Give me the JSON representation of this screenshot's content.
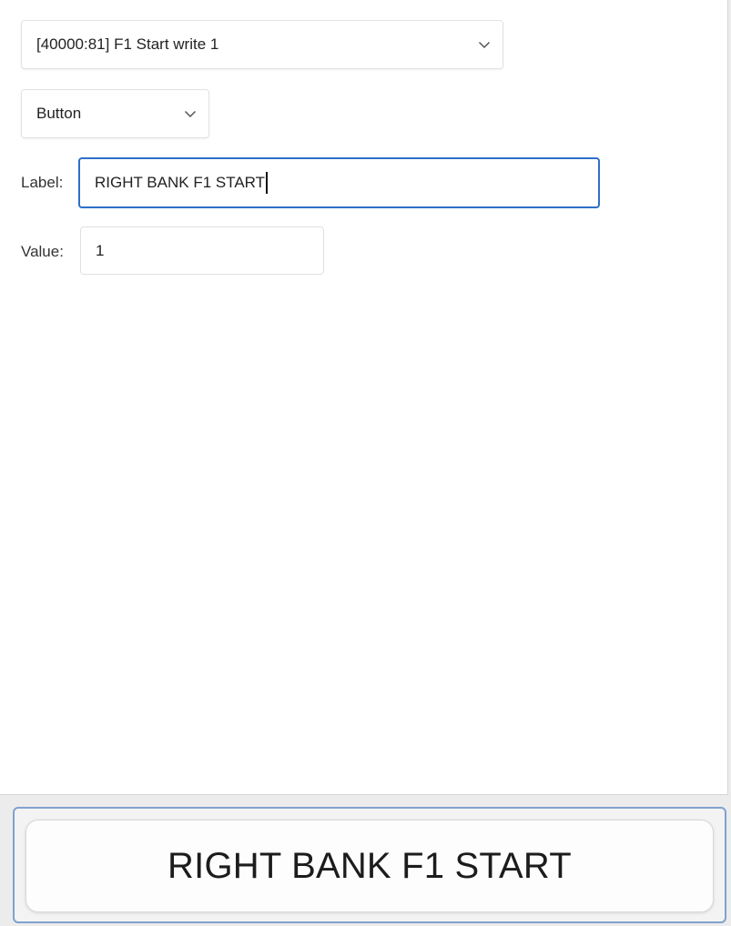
{
  "register_select": {
    "value": "[40000:81] F1 Start write 1",
    "icon": "chevron-down-icon"
  },
  "control_type_select": {
    "value": "Button",
    "icon": "chevron-down-icon"
  },
  "label_field": {
    "caption": "Label:",
    "value": "RIGHT BANK F1 START"
  },
  "value_field": {
    "caption": "Value:",
    "value": "1"
  },
  "preview": {
    "button_label": "RIGHT BANK F1 START"
  },
  "colors": {
    "focus_border": "#2e6fc8",
    "preview_border": "#7ea2cf"
  }
}
